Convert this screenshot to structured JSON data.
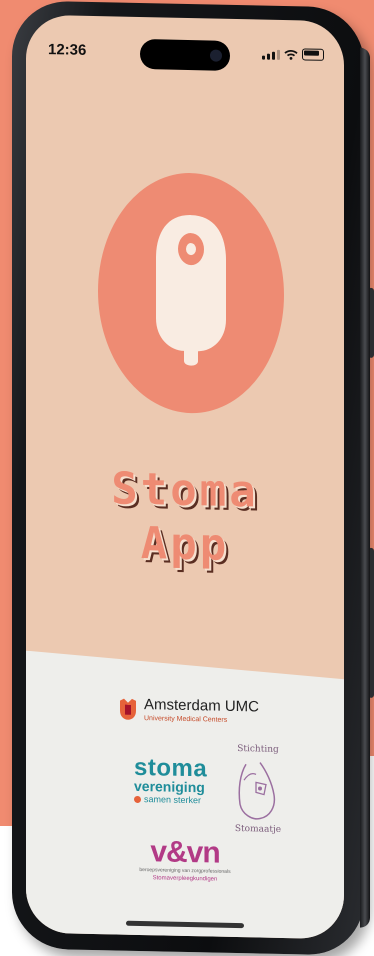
{
  "status_bar": {
    "time": "12:36",
    "icons": [
      "signal-icon",
      "wifi-icon",
      "battery-icon"
    ]
  },
  "app": {
    "title_line1": "Stoma",
    "title_line2": "App",
    "logo_icon": "ostomy-pouch-icon"
  },
  "partners": {
    "amsterdam_umc": {
      "name": "Amsterdam UMC",
      "subtitle": "University Medical Centers"
    },
    "stoma_vereniging": {
      "line1": "stoma",
      "line2": "vereniging",
      "tagline": "samen sterker"
    },
    "stichting_stomaatje": {
      "top": "Stichting",
      "bottom": "Stomaatje"
    },
    "vvn": {
      "logo": "v&vn",
      "subtitle": "beroepsvereniging van zorgprofessionals",
      "department": "Stomaverpleegkundigen"
    }
  },
  "colors": {
    "background": "#f08b70",
    "screen_bg": "#ecc9b1",
    "accent": "#ee8b73",
    "footer_bg": "#eeeeeb",
    "stoma_teal": "#1f8d9a",
    "vvn_purple": "#b23a86"
  }
}
